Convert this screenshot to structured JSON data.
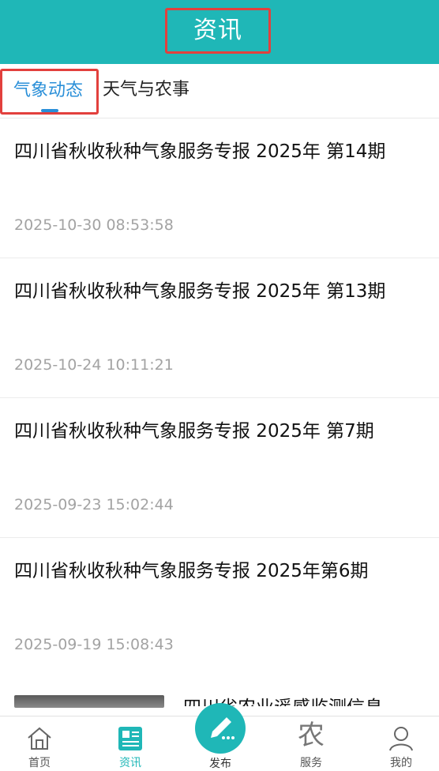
{
  "header": {
    "title": "资讯"
  },
  "tabs": [
    {
      "label": "气象动态",
      "active": true
    },
    {
      "label": "天气与农事",
      "active": false
    }
  ],
  "articles": [
    {
      "title": "四川省秋收秋种气象服务专报 2025年 第14期",
      "time": "2025-10-30 08:53:58"
    },
    {
      "title": "四川省秋收秋种气象服务专报 2025年 第13期",
      "time": "2025-10-24 10:11:21"
    },
    {
      "title": "四川省秋收秋种气象服务专报 2025年 第7期",
      "time": "2025-09-23 15:02:44"
    },
    {
      "title": "四川省秋收秋种气象服务专报 2025年第6期",
      "time": "2025-09-19 15:08:43"
    }
  ],
  "partial_article": {
    "title": "四川省农业遥感监测信息"
  },
  "bottom_nav": [
    {
      "label": "首页",
      "icon": "home-icon"
    },
    {
      "label": "资讯",
      "icon": "news-icon",
      "active": true
    },
    {
      "label": "发布",
      "icon": "pencil-icon"
    },
    {
      "label": "服务",
      "icon": "nong-icon",
      "glyph": "农"
    },
    {
      "label": "我的",
      "icon": "user-icon"
    }
  ],
  "colors": {
    "accent": "#1fb7b7",
    "tab_active": "#2a8fd8",
    "highlight_border": "#e2403d",
    "time_text": "#a3a3a3"
  }
}
